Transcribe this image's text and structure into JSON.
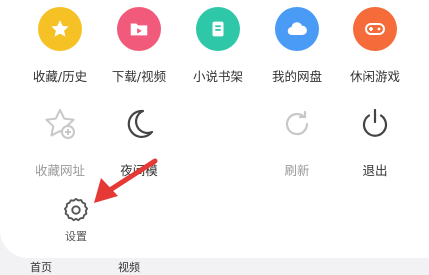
{
  "menu": {
    "row1": [
      {
        "label": "收藏/历史",
        "icon": "star-icon",
        "color": "#f5c125"
      },
      {
        "label": "下载/视频",
        "icon": "video-folder-icon",
        "color": "#f25a7b"
      },
      {
        "label": "小说书架",
        "icon": "book-icon",
        "color": "#2ec8a9"
      },
      {
        "label": "我的网盘",
        "icon": "cloud-icon",
        "color": "#4a9bf5"
      },
      {
        "label": "休闲游戏",
        "icon": "gamepad-icon",
        "color": "#f56b3a"
      }
    ],
    "row2": [
      {
        "label": "收藏网址",
        "icon": "star-add-icon",
        "enabled": false
      },
      {
        "label": "夜间模",
        "icon": "moon-icon",
        "enabled": true
      },
      {
        "label": "刷新",
        "icon": "refresh-icon",
        "enabled": false
      },
      {
        "label": "退出",
        "icon": "power-icon",
        "enabled": true
      }
    ]
  },
  "settings": {
    "label": "设置",
    "icon": "gear-icon"
  },
  "bottom_tabs": [
    "首页",
    "视频"
  ],
  "annotation": {
    "color": "#e53935"
  }
}
